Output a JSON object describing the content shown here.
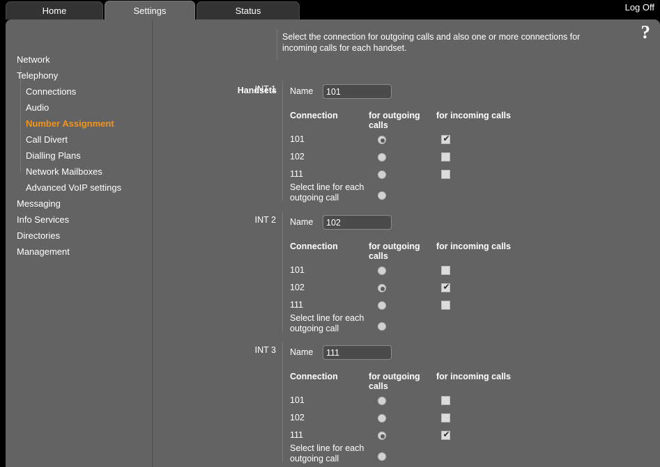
{
  "tabs": [
    {
      "label": "Home",
      "active": false
    },
    {
      "label": "Settings",
      "active": true
    },
    {
      "label": "Status",
      "active": false
    }
  ],
  "logoff_label": "Log Off",
  "help_icon": "?",
  "colors": {
    "accent_selected_nav": "#f0951f",
    "panel_bg": "#636363",
    "tab_inactive_bg": "#333333",
    "input_bg": "#4b4b4b",
    "control_light": "#d2d2d2"
  },
  "sidebar": {
    "items": [
      {
        "label": "Network",
        "level": "top",
        "selected": false
      },
      {
        "label": "Telephony",
        "level": "top",
        "selected": false
      },
      {
        "label": "Connections",
        "level": "sub",
        "selected": false
      },
      {
        "label": "Audio",
        "level": "sub",
        "selected": false
      },
      {
        "label": "Number Assignment",
        "level": "sub",
        "selected": true
      },
      {
        "label": "Call Divert",
        "level": "sub",
        "selected": false
      },
      {
        "label": "Dialling Plans",
        "level": "sub",
        "selected": false
      },
      {
        "label": "Network Mailboxes",
        "level": "sub",
        "selected": false
      },
      {
        "label": "Advanced VoIP settings",
        "level": "sub",
        "selected": false
      },
      {
        "label": "Messaging",
        "level": "top",
        "selected": false
      },
      {
        "label": "Info Services",
        "level": "top",
        "selected": false
      },
      {
        "label": "Directories",
        "level": "top",
        "selected": false
      },
      {
        "label": "Management",
        "level": "top",
        "selected": false
      }
    ]
  },
  "content": {
    "intro": "Select the connection for outgoing calls and also one or more connections for incoming calls for each handset.",
    "handsets_label": "Handsets",
    "name_label": "Name",
    "columns": {
      "connection": "Connection",
      "outgoing": "for outgoing calls",
      "incoming": "for incoming calls"
    },
    "select_line_label": "Select line for each outgoing call",
    "handsets": [
      {
        "int_label": "INT 1",
        "name_value": "101",
        "rows": [
          {
            "connection": "101",
            "outgoing": true,
            "incoming": true
          },
          {
            "connection": "102",
            "outgoing": false,
            "incoming": false
          },
          {
            "connection": "111",
            "outgoing": false,
            "incoming": false
          }
        ],
        "select_line_outgoing": false
      },
      {
        "int_label": "INT 2",
        "name_value": "102",
        "rows": [
          {
            "connection": "101",
            "outgoing": false,
            "incoming": false
          },
          {
            "connection": "102",
            "outgoing": true,
            "incoming": true
          },
          {
            "connection": "111",
            "outgoing": false,
            "incoming": false
          }
        ],
        "select_line_outgoing": false
      },
      {
        "int_label": "INT 3",
        "name_value": "111",
        "rows": [
          {
            "connection": "101",
            "outgoing": false,
            "incoming": false
          },
          {
            "connection": "102",
            "outgoing": false,
            "incoming": false
          },
          {
            "connection": "111",
            "outgoing": true,
            "incoming": true
          }
        ],
        "select_line_outgoing": false
      }
    ]
  }
}
